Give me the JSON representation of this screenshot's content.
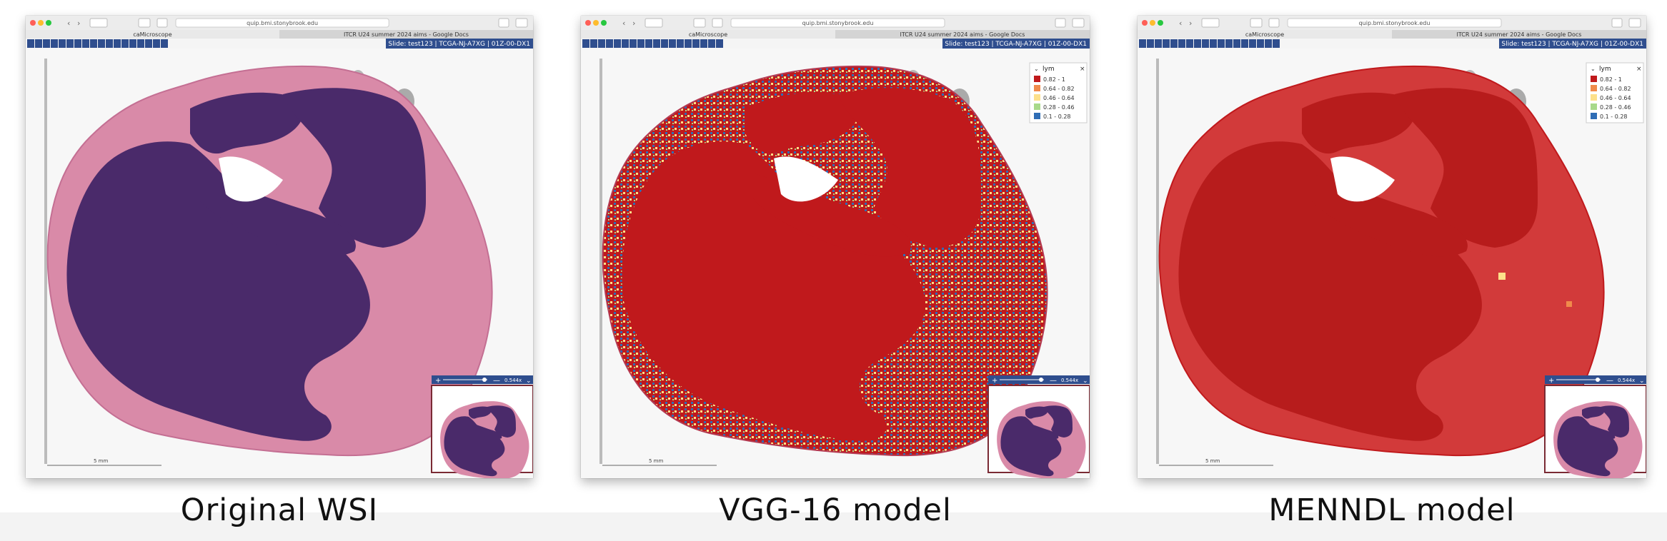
{
  "browser": {
    "url": "quip.bmi.stonybrook.edu",
    "tabs": [
      "caMicroscope",
      "ITCR U24 summer 2024 aims - Google Docs"
    ]
  },
  "viewer": {
    "slide_label": "Slide: test123 | TCGA-NJ-A7XG | 01Z-00-DX1",
    "zoom_value": "0.544x",
    "scale_bar_label": "5 mm"
  },
  "legend": {
    "title": "lym",
    "items": [
      {
        "label": "0.82 - 1",
        "color": "#c0191c"
      },
      {
        "label": "0.64 - 0.82",
        "color": "#f08a4b"
      },
      {
        "label": "0.46 - 0.64",
        "color": "#fde08a"
      },
      {
        "label": "0.28 - 0.46",
        "color": "#a8d98a"
      },
      {
        "label": "0.1 - 0.28",
        "color": "#2f6db5"
      }
    ]
  },
  "panels": [
    {
      "caption": "Original WSI",
      "show_legend": false
    },
    {
      "caption": "VGG-16 model",
      "show_legend": true
    },
    {
      "caption": "MENNDL model",
      "show_legend": true
    }
  ],
  "colors": {
    "toolbar_blue": "#2f4e8e",
    "tissue_purple": "#4a2a6a",
    "stroma_pink": "#d98aa8",
    "heat_red": "#c0191c"
  },
  "icons": [
    "apps-icon",
    "list-icon",
    "home-icon",
    "pen-icon",
    "eyedropper-icon",
    "search-icon",
    "ruler-icon",
    "contrast-icon",
    "share-icon",
    "layers-icon",
    "image-icon",
    "label-icon",
    "chart-icon",
    "heatmap-icon",
    "annotation-icon",
    "camera-icon",
    "help-icon",
    "collapse-icon"
  ]
}
